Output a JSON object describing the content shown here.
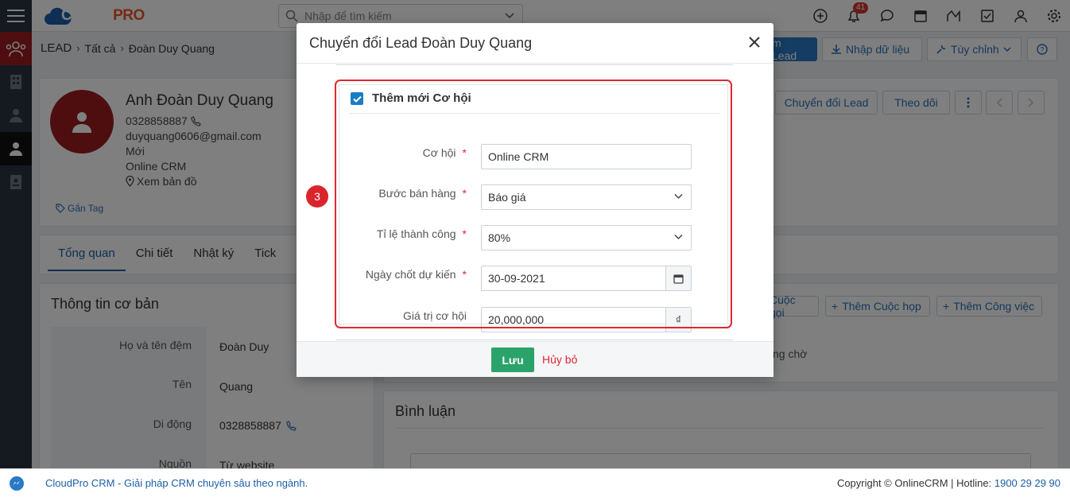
{
  "app": {
    "logo_text": "CLOUD",
    "logo_text_accent": "PRO"
  },
  "search": {
    "placeholder": "Nhập để tìm kiếm"
  },
  "topbar": {
    "notification_count": "41"
  },
  "breadcrumb": {
    "module": "LEAD",
    "list": "Tất cả",
    "record": "Đoàn Duy Quang"
  },
  "header_buttons": {
    "add": "m Lead",
    "import": "Nhập dữ liệu",
    "customize": "Tùy chỉnh"
  },
  "lead": {
    "name": "Anh Đoàn Duy Quang",
    "phone": "0328858887",
    "email": "duyquang0606@gmail.com",
    "status": "Mới",
    "product": "Online CRM",
    "map": "Xem bản đồ",
    "tag": "Gắn Tag"
  },
  "record_buttons": {
    "convert": "Chuyển đổi Lead",
    "follow": "Theo dõi"
  },
  "tabs": [
    {
      "label": "Tổng quan"
    },
    {
      "label": "Chi tiết"
    },
    {
      "label": "Nhật ký"
    },
    {
      "label": "Tick"
    }
  ],
  "basic_info": {
    "title": "Thông tin cơ bản",
    "rows": [
      {
        "label": "Họ và tên đệm",
        "value": "Đoàn Duy"
      },
      {
        "label": "Tên",
        "value": "Quang"
      },
      {
        "label": "Di động",
        "value": "0328858887"
      },
      {
        "label": "Nguồn",
        "value": "Từ website"
      }
    ]
  },
  "activity": {
    "call": "Cuộc gọi",
    "meeting": "Thêm Cuộc họp",
    "task": "Thêm Công việc",
    "pending": "ng chờ"
  },
  "comments": {
    "title": "Bình luận"
  },
  "footer": {
    "left": "CloudPro CRM - Giải pháp CRM chuyên sâu theo ngành.",
    "right": "Copyright © OnlineCRM | Hotline: ",
    "hotline": "1900 29 29 90"
  },
  "modal": {
    "title": "Chuyển đổi Lead Đoàn Duy Quang",
    "section_label": "Thêm mới Cơ hội",
    "fields": {
      "opportunity": {
        "label": "Cơ hội",
        "value": "Online CRM"
      },
      "stage": {
        "label": "Bước bán hàng",
        "value": "Báo giá"
      },
      "probability": {
        "label": "Tỉ lệ thành công",
        "value": "80%"
      },
      "close_date": {
        "label": "Ngày chốt dự kiến",
        "value": "30-09-2021"
      },
      "amount": {
        "label": "Giá trị cơ hội",
        "value": "20,000,000",
        "currency": "₫"
      }
    },
    "required_mark": "*",
    "save": "Lưu",
    "cancel": "Hủy bỏ"
  },
  "annotation": {
    "step": "3"
  },
  "colors": {
    "primary": "#1d5fa7",
    "save": "#2aa36b",
    "highlight": "#e0272f",
    "sidebar": "#2a3340"
  }
}
